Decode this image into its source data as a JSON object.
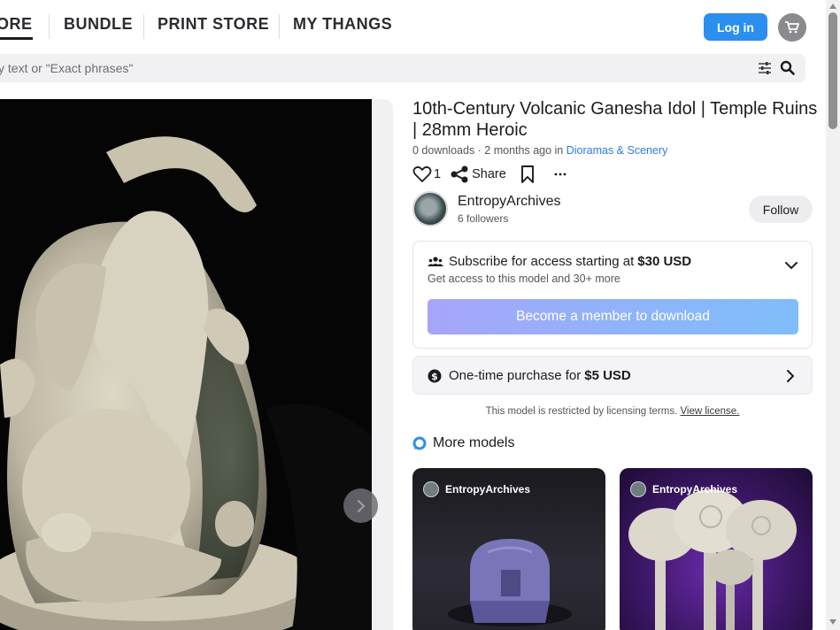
{
  "nav": {
    "tabs": [
      {
        "label": "ORE",
        "active": true
      },
      {
        "label": "BUNDLE",
        "active": false
      },
      {
        "label": "PRINT STORE",
        "active": false
      },
      {
        "label": "MY THANGS",
        "active": false
      }
    ],
    "login_label": "Log in",
    "cart_icon": "cart-icon",
    "accent_color": "#2b8ff0"
  },
  "search": {
    "placeholder": "y text or \"Exact phrases\"",
    "filter_icon": "sliders-icon",
    "search_icon": "search-icon"
  },
  "gallery": {
    "next_icon": "chevron-right-icon"
  },
  "model": {
    "title": "10th-Century Volcanic Ganesha Idol | Temple Ruins | 28mm Heroic",
    "meta_prefix": "0 downloads · 2 months ago in ",
    "category": "Dioramas & Scenery",
    "likes": "1",
    "share_label": "Share",
    "more_icon": "ellipsis-icon"
  },
  "creator": {
    "name": "EntropyArchives",
    "followers": "6 followers",
    "follow_label": "Follow"
  },
  "subscription": {
    "title_prefix": "Subscribe for access starting at",
    "price": "$30 USD",
    "description": "Get access to this model and 30+ more",
    "member_button": "Become a member to download"
  },
  "purchase": {
    "label_prefix": "One-time purchase for",
    "price": "$5 USD"
  },
  "license": {
    "text": "This model is restricted by licensing terms.",
    "link": "View license."
  },
  "more_models": {
    "heading": "More models",
    "cards": [
      {
        "creator": "EntropyArchives"
      },
      {
        "creator": "EntropyArchives"
      }
    ]
  }
}
